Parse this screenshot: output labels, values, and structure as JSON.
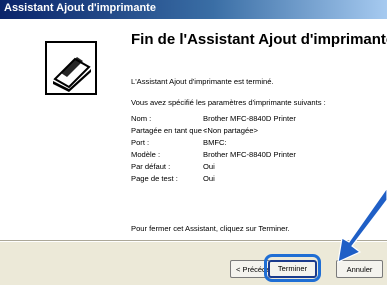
{
  "window": {
    "title": "Assistant Ajout d'imprimante"
  },
  "wizard": {
    "heading": "Fin de l'Assistant Ajout d'imprimante",
    "intro": "L'Assistant Ajout d'imprimante est terminé.",
    "settings_intro": "Vous avez spécifié les paramètres d'imprimante suivants :",
    "settings": [
      {
        "label": "Nom :",
        "value": "Brother MFC-8840D Printer"
      },
      {
        "label": "Partagée en tant que :",
        "value": "<Non partagée>"
      },
      {
        "label": "Port :",
        "value": "BMFC:"
      },
      {
        "label": "Modèle :",
        "value": "Brother MFC-8840D Printer"
      },
      {
        "label": "Par défaut :",
        "value": "Oui"
      },
      {
        "label": "Page de test :",
        "value": "Oui"
      }
    ],
    "closing": "Pour fermer cet Assistant, cliquez sur Terminer."
  },
  "buttons": {
    "back": "< Précéde",
    "finish": "Terminer",
    "cancel": "Annuler"
  },
  "icons": {
    "wizard": "printer-icon",
    "pointer": "arrow-pointer-icon"
  },
  "colors": {
    "titlebar": "#0a246a",
    "highlight": "#1f6ed4",
    "arrow": "#1f5fc6"
  }
}
